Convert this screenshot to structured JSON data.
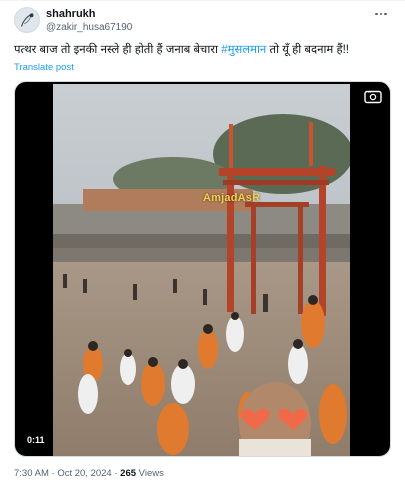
{
  "author": {
    "display_name": "shahrukh",
    "handle": "@zakir_husa67190",
    "avatar_icon": "avatar-image"
  },
  "post": {
    "text_before": "पत्थर बाज तो इनकी नस्ले ही होती हैं जनाब बेचारा ",
    "hashtag": "#मुसलमान",
    "text_after": " तो यूँ ही बदनाम हैं!!",
    "translate_label": "Translate post"
  },
  "video": {
    "watermark": "AmjadAsR",
    "duration": "0:11",
    "caption_icon": "closed-captions-icon"
  },
  "meta": {
    "time": "7:30 AM",
    "separator": "·",
    "date": "Oct 20, 2024",
    "views_count": "265",
    "views_label": "Views"
  },
  "colors": {
    "link": "#1d9bf0",
    "text": "#0f1419",
    "secondary": "#536471",
    "watermark": "#f4d24b"
  }
}
